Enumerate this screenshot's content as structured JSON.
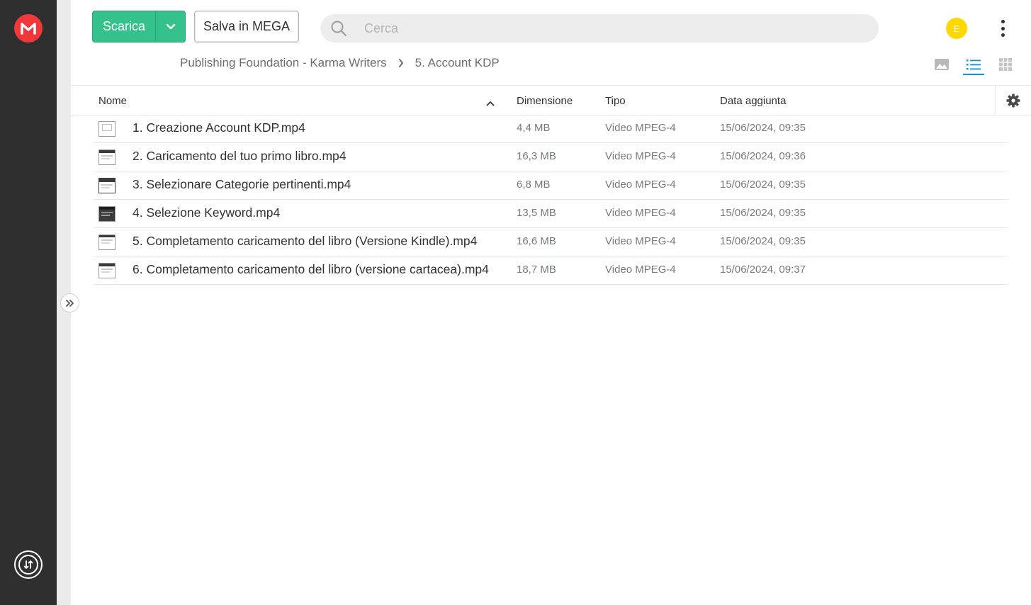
{
  "toolbar": {
    "download_label": "Scarica",
    "save_label": "Salva in MEGA"
  },
  "search": {
    "placeholder": "Cerca"
  },
  "user": {
    "avatar_initial": "E",
    "avatar_color": "#ffd800"
  },
  "breadcrumb": [
    {
      "label": "Publishing Foundation - Karma Writers"
    },
    {
      "label": "5. Account KDP"
    }
  ],
  "view_modes": {
    "options": [
      "thumbnail-view-icon",
      "list-view-icon",
      "grid-view-icon"
    ],
    "active": "list-view-icon"
  },
  "table": {
    "columns": {
      "name": "Nome",
      "size": "Dimensione",
      "type": "Tipo",
      "date": "Data aggiunta"
    },
    "rows": [
      {
        "name": "1. Creazione Account KDP.mp4",
        "size": "4,4 MB",
        "type": "Video MPEG-4",
        "date": "15/06/2024, 09:35"
      },
      {
        "name": "2. Caricamento del tuo primo libro.mp4",
        "size": "16,3 MB",
        "type": "Video MPEG-4",
        "date": "15/06/2024, 09:36"
      },
      {
        "name": "3. Selezionare Categorie pertinenti.mp4",
        "size": "6,8 MB",
        "type": "Video MPEG-4",
        "date": "15/06/2024, 09:35"
      },
      {
        "name": "4. Selezione Keyword.mp4",
        "size": "13,5 MB",
        "type": "Video MPEG-4",
        "date": "15/06/2024, 09:35"
      },
      {
        "name": "5. Completamento caricamento del libro (Versione Kindle).mp4",
        "size": "16,6 MB",
        "type": "Video MPEG-4",
        "date": "15/06/2024, 09:35"
      },
      {
        "name": "6. Completamento caricamento del libro (versione cartacea).mp4",
        "size": "18,7 MB",
        "type": "Video MPEG-4",
        "date": "15/06/2024, 09:37"
      }
    ]
  },
  "colors": {
    "brand_red": "#f0373a",
    "download_green": "#35c18b",
    "active_view_blue": "#1a8ec9",
    "sidebar_dark": "#2f2f2f"
  }
}
